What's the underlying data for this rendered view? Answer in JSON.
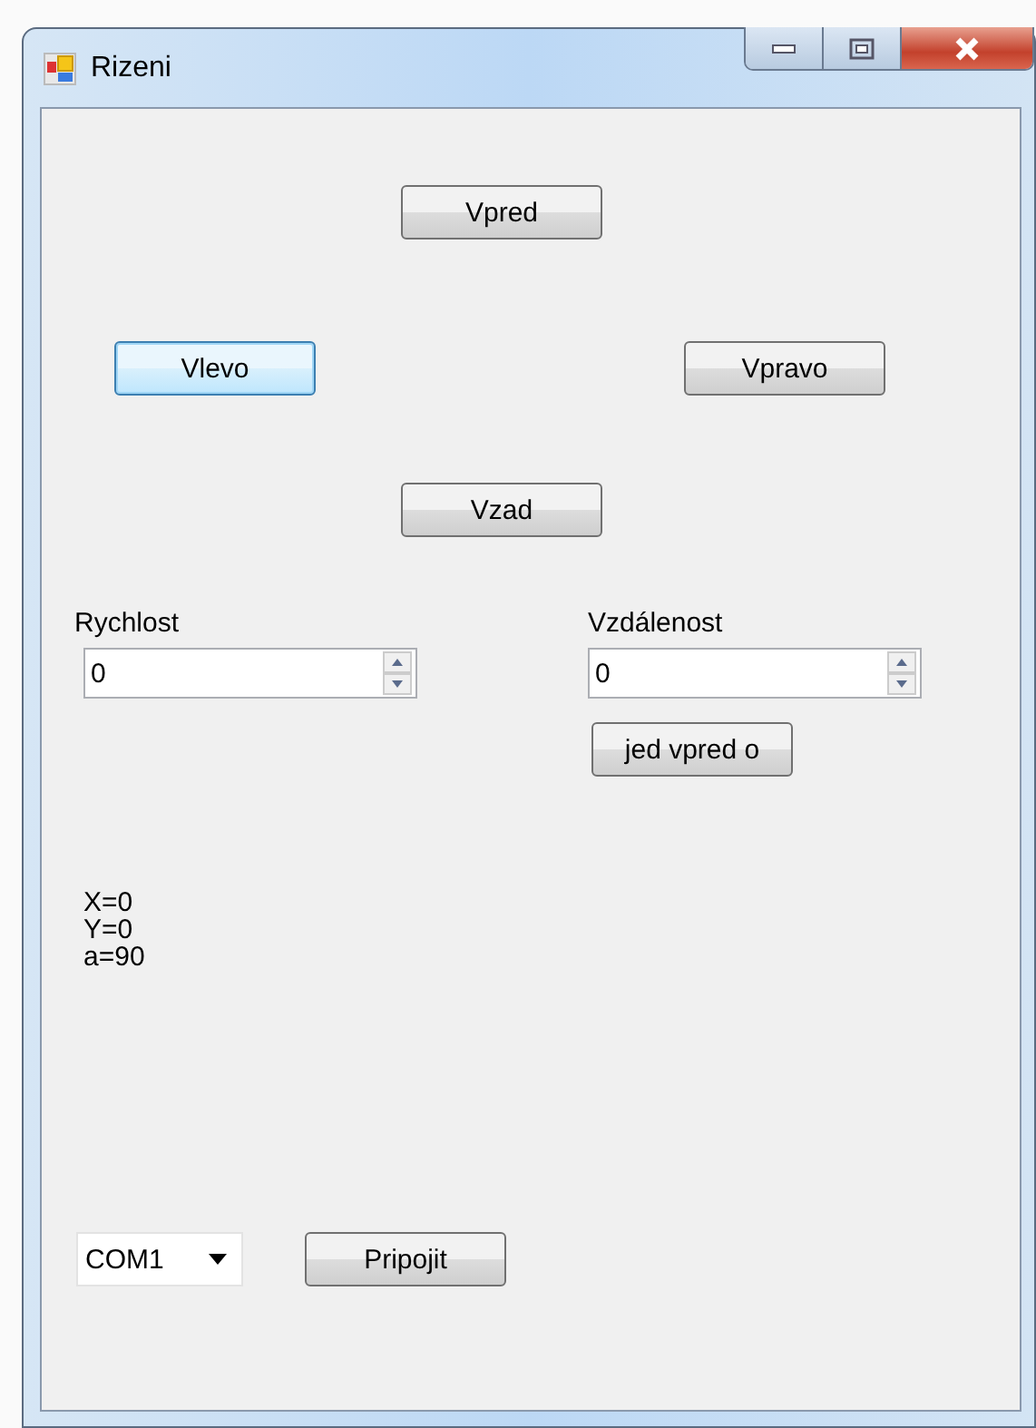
{
  "window": {
    "title": "Rizeni"
  },
  "direction_buttons": [
    {
      "label": "Vpred",
      "focused": false
    },
    {
      "label": "Vlevo",
      "focused": true
    },
    {
      "label": "Vpravo",
      "focused": false
    },
    {
      "label": "Vzad",
      "focused": false
    }
  ],
  "speed": {
    "label": "Rychlost",
    "value": "0"
  },
  "distance": {
    "label": "Vzdálenost",
    "value": "0"
  },
  "drive_button": "jed vpred o",
  "position": [
    "X=0",
    "Y=0",
    "a=90"
  ],
  "port": {
    "value": "COM1"
  },
  "connect_button": "Pripojit"
}
